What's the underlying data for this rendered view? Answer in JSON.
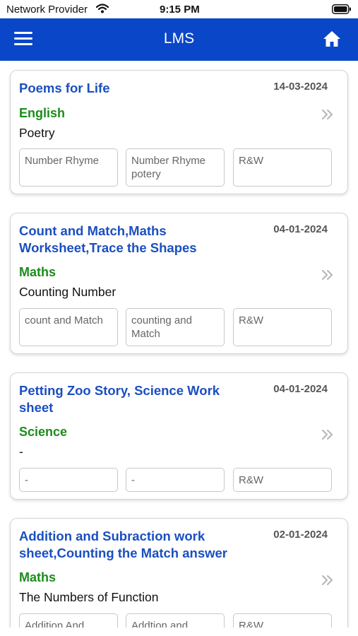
{
  "status_bar": {
    "carrier": "Network Provider",
    "time": "9:15 PM"
  },
  "app_bar": {
    "title": "LMS",
    "menu_icon": "hamburger-menu-icon",
    "home_icon": "home-icon"
  },
  "colors": {
    "app_bar": "#0a46c8",
    "title": "#1a4fc0",
    "subject": "#1c8c1c"
  },
  "cards": [
    {
      "title": "Poems for Life",
      "date": "14-03-2024",
      "subject": "English",
      "topic": "Poetry",
      "tags": [
        "Number Rhyme",
        "Number Rhyme potery",
        "R&W"
      ]
    },
    {
      "title": "Count and Match,Maths Worksheet,Trace the Shapes",
      "date": "04-01-2024",
      "subject": "Maths",
      "topic": "Counting Number",
      "tags": [
        "count and Match",
        "counting and Match",
        "R&W"
      ]
    },
    {
      "title": "Petting Zoo Story, Science Work sheet",
      "date": "04-01-2024",
      "subject": "Science",
      "topic": "-",
      "tags": [
        "-",
        "-",
        "R&W"
      ]
    },
    {
      "title": "Addition and Subraction work sheet,Counting the Match answer",
      "date": "02-01-2024",
      "subject": "Maths",
      "topic": "The Numbers of Function",
      "tags": [
        "Addition And",
        "Addtion and",
        "R&W"
      ]
    }
  ]
}
